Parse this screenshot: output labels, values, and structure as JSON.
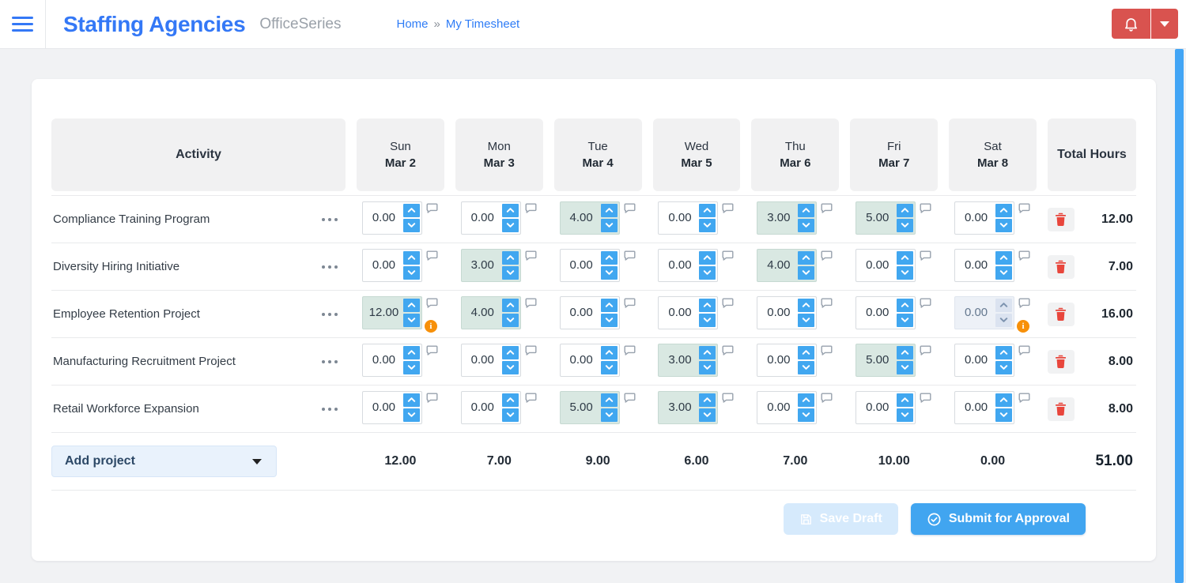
{
  "header": {
    "brand": "Staffing Agencies",
    "product": "OfficeSeries",
    "breadcrumb": {
      "home": "Home",
      "separator": "»",
      "current": "My Timesheet"
    }
  },
  "table": {
    "activity_header": "Activity",
    "total_header": "Total Hours",
    "days": [
      {
        "name": "Sun",
        "date": "Mar 2"
      },
      {
        "name": "Mon",
        "date": "Mar 3"
      },
      {
        "name": "Tue",
        "date": "Mar 4"
      },
      {
        "name": "Wed",
        "date": "Mar 5"
      },
      {
        "name": "Thu",
        "date": "Mar 6"
      },
      {
        "name": "Fri",
        "date": "Mar 7"
      },
      {
        "name": "Sat",
        "date": "Mar 8"
      }
    ],
    "rows": [
      {
        "activity": "Compliance Training Program",
        "cells": [
          {
            "value": "0.00"
          },
          {
            "value": "0.00"
          },
          {
            "value": "4.00",
            "filled": true
          },
          {
            "value": "0.00"
          },
          {
            "value": "3.00",
            "filled": true
          },
          {
            "value": "5.00",
            "filled": true
          },
          {
            "value": "0.00"
          }
        ],
        "total": "12.00"
      },
      {
        "activity": "Diversity Hiring Initiative",
        "cells": [
          {
            "value": "0.00"
          },
          {
            "value": "3.00",
            "filled": true
          },
          {
            "value": "0.00"
          },
          {
            "value": "0.00"
          },
          {
            "value": "4.00",
            "filled": true
          },
          {
            "value": "0.00"
          },
          {
            "value": "0.00"
          }
        ],
        "total": "7.00"
      },
      {
        "activity": "Employee Retention Project",
        "cells": [
          {
            "value": "12.00",
            "filled": true,
            "warning": true
          },
          {
            "value": "4.00",
            "filled": true
          },
          {
            "value": "0.00"
          },
          {
            "value": "0.00"
          },
          {
            "value": "0.00"
          },
          {
            "value": "0.00"
          },
          {
            "value": "0.00",
            "disabled": true,
            "warning": true
          }
        ],
        "total": "16.00"
      },
      {
        "activity": "Manufacturing Recruitment Project",
        "cells": [
          {
            "value": "0.00"
          },
          {
            "value": "0.00"
          },
          {
            "value": "0.00"
          },
          {
            "value": "3.00",
            "filled": true
          },
          {
            "value": "0.00"
          },
          {
            "value": "5.00",
            "filled": true
          },
          {
            "value": "0.00"
          }
        ],
        "total": "8.00"
      },
      {
        "activity": "Retail Workforce Expansion",
        "cells": [
          {
            "value": "0.00"
          },
          {
            "value": "0.00"
          },
          {
            "value": "5.00",
            "filled": true
          },
          {
            "value": "3.00",
            "filled": true
          },
          {
            "value": "0.00"
          },
          {
            "value": "0.00"
          },
          {
            "value": "0.00"
          }
        ],
        "total": "8.00"
      }
    ],
    "footer": {
      "add_project_label": "Add project",
      "day_totals": [
        "12.00",
        "7.00",
        "9.00",
        "6.00",
        "7.00",
        "10.00",
        "0.00"
      ],
      "grand_total": "51.00"
    }
  },
  "actions": {
    "save_draft_label": "Save Draft",
    "submit_label": "Submit for Approval"
  },
  "colors": {
    "brand_blue": "#3478f6",
    "accent_blue": "#41a7f0",
    "danger_red": "#d9534f",
    "filled_cell_bg": "#d9e8e2",
    "warning_orange": "#f79009",
    "scrollbar_blue": "#42a5f5"
  }
}
